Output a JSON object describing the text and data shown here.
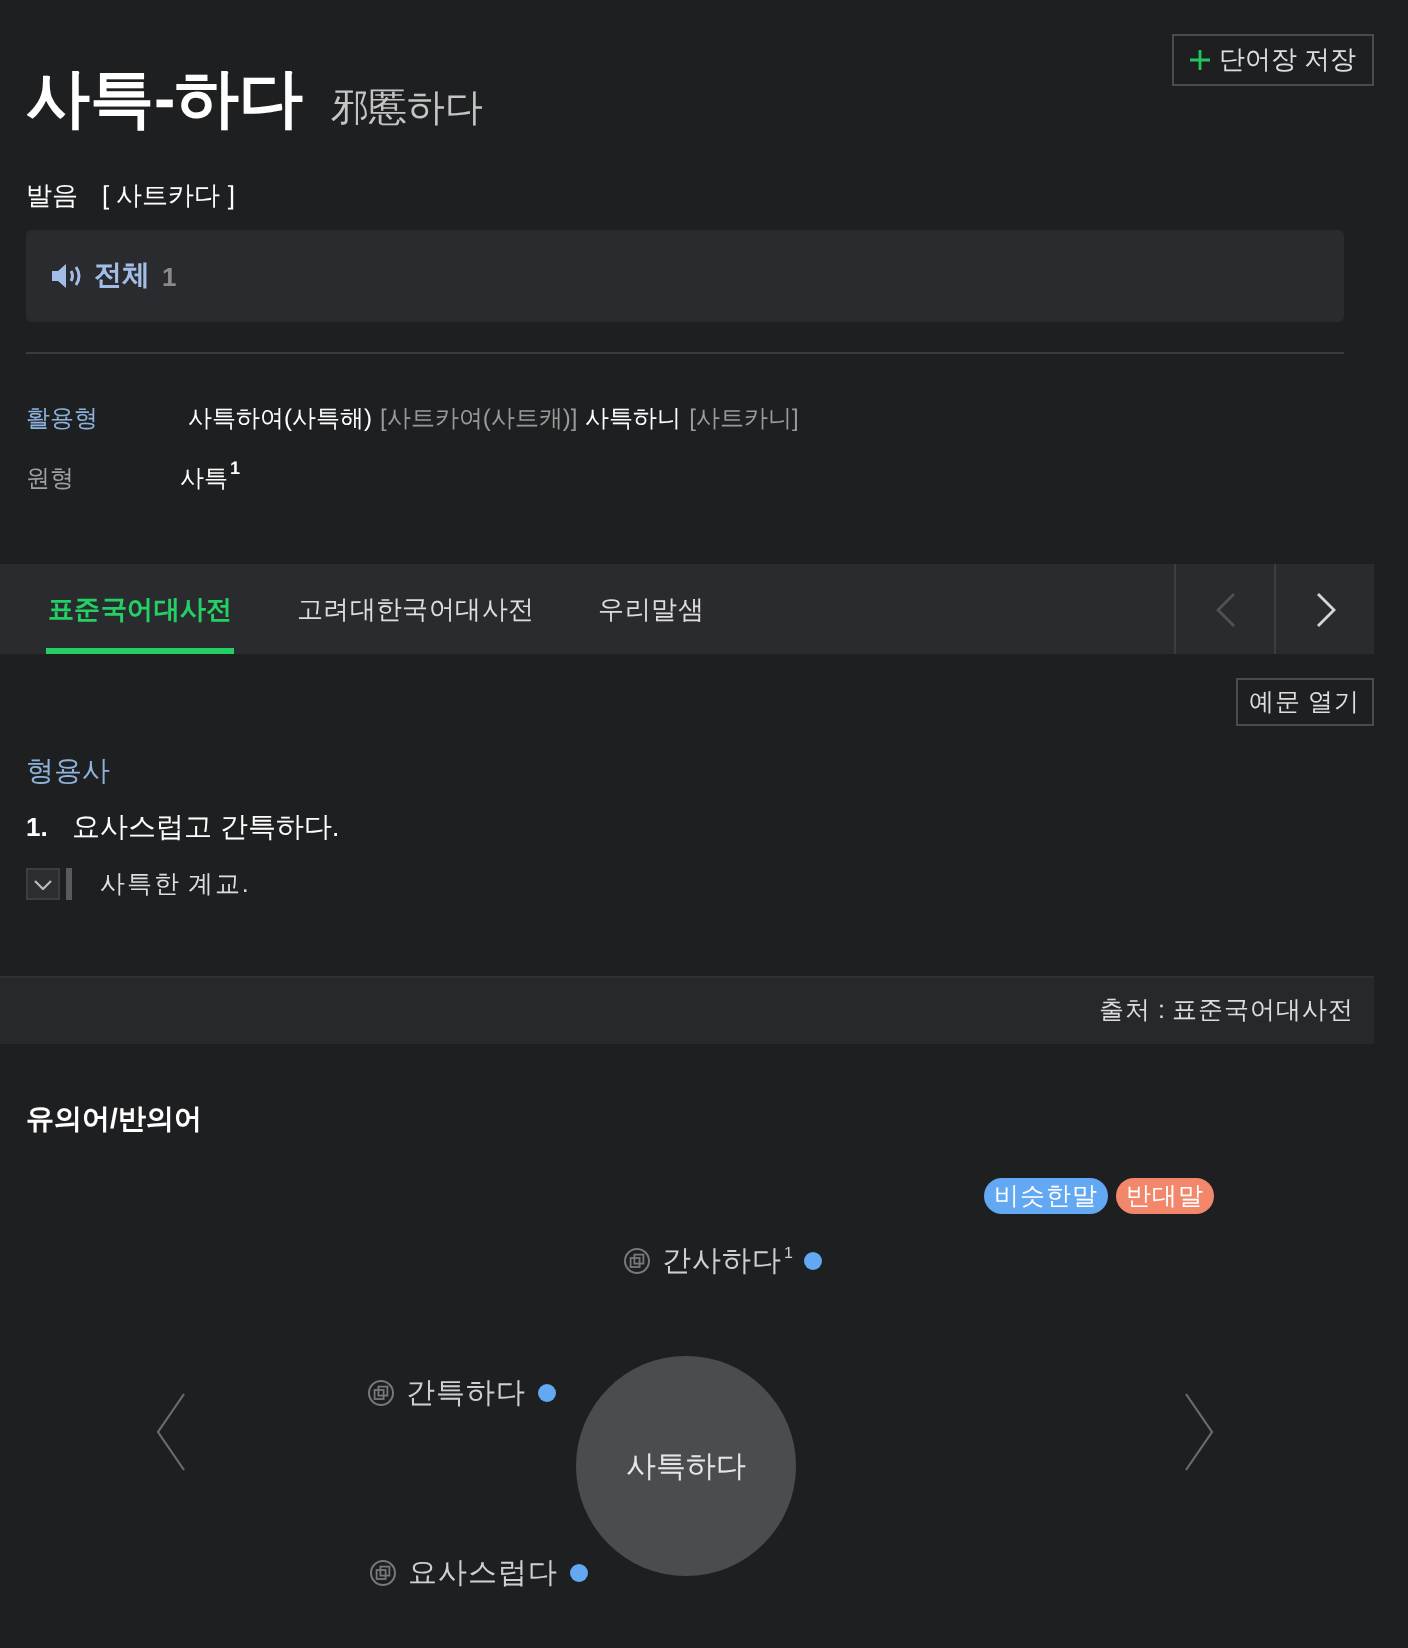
{
  "entry": {
    "headword": "사특-하다",
    "hanja": "邪慝하다",
    "save_button": "단어장 저장"
  },
  "pronunciation": {
    "label": "발음",
    "value": "[ 사트카다 ]"
  },
  "audio": {
    "label": "전체",
    "count": "1"
  },
  "conjugation": {
    "label": "활용형",
    "forms": [
      {
        "form": "사특하여(사특해)",
        "pronunciation": "[사트카여(사트캐)]"
      },
      {
        "form": "사특하니",
        "pronunciation": "[사트카니]"
      }
    ]
  },
  "base_form": {
    "label": "원형",
    "value": "사특$^{1}$"
  },
  "dictionary_tabs": [
    {
      "label": "표준국어대사전",
      "selected": true
    },
    {
      "label": "고려대한국어대사전",
      "selected": false
    },
    {
      "label": "우리말샘",
      "selected": false
    }
  ],
  "tab_nav": [
    {
      "kind": "prev",
      "disabled": true
    },
    {
      "kind": "next",
      "disabled": false
    }
  ],
  "examples_button": "예문 열기",
  "senses": {
    "part_of_speech": "형용사",
    "items": [
      {
        "number": "1.",
        "definition": "요사스럽고 간특하다.",
        "examples": [
          "사특한 계교."
        ]
      }
    ]
  },
  "source": "출처 : 표준국어대사전",
  "related": {
    "title": "유의어/반의어",
    "legend": [
      {
        "label": "비슷한말",
        "color": "#62a8f2"
      },
      {
        "label": "반대말",
        "color": "#f2876c"
      }
    ],
    "center": "사특하다",
    "words": [
      {
        "label": "간사하다$^{1}$",
        "color": "#62a8f2"
      },
      {
        "label": "간특하다",
        "color": "#62a8f2"
      },
      {
        "label": "요사스럽다",
        "color": "#62a8f2"
      }
    ]
  }
}
